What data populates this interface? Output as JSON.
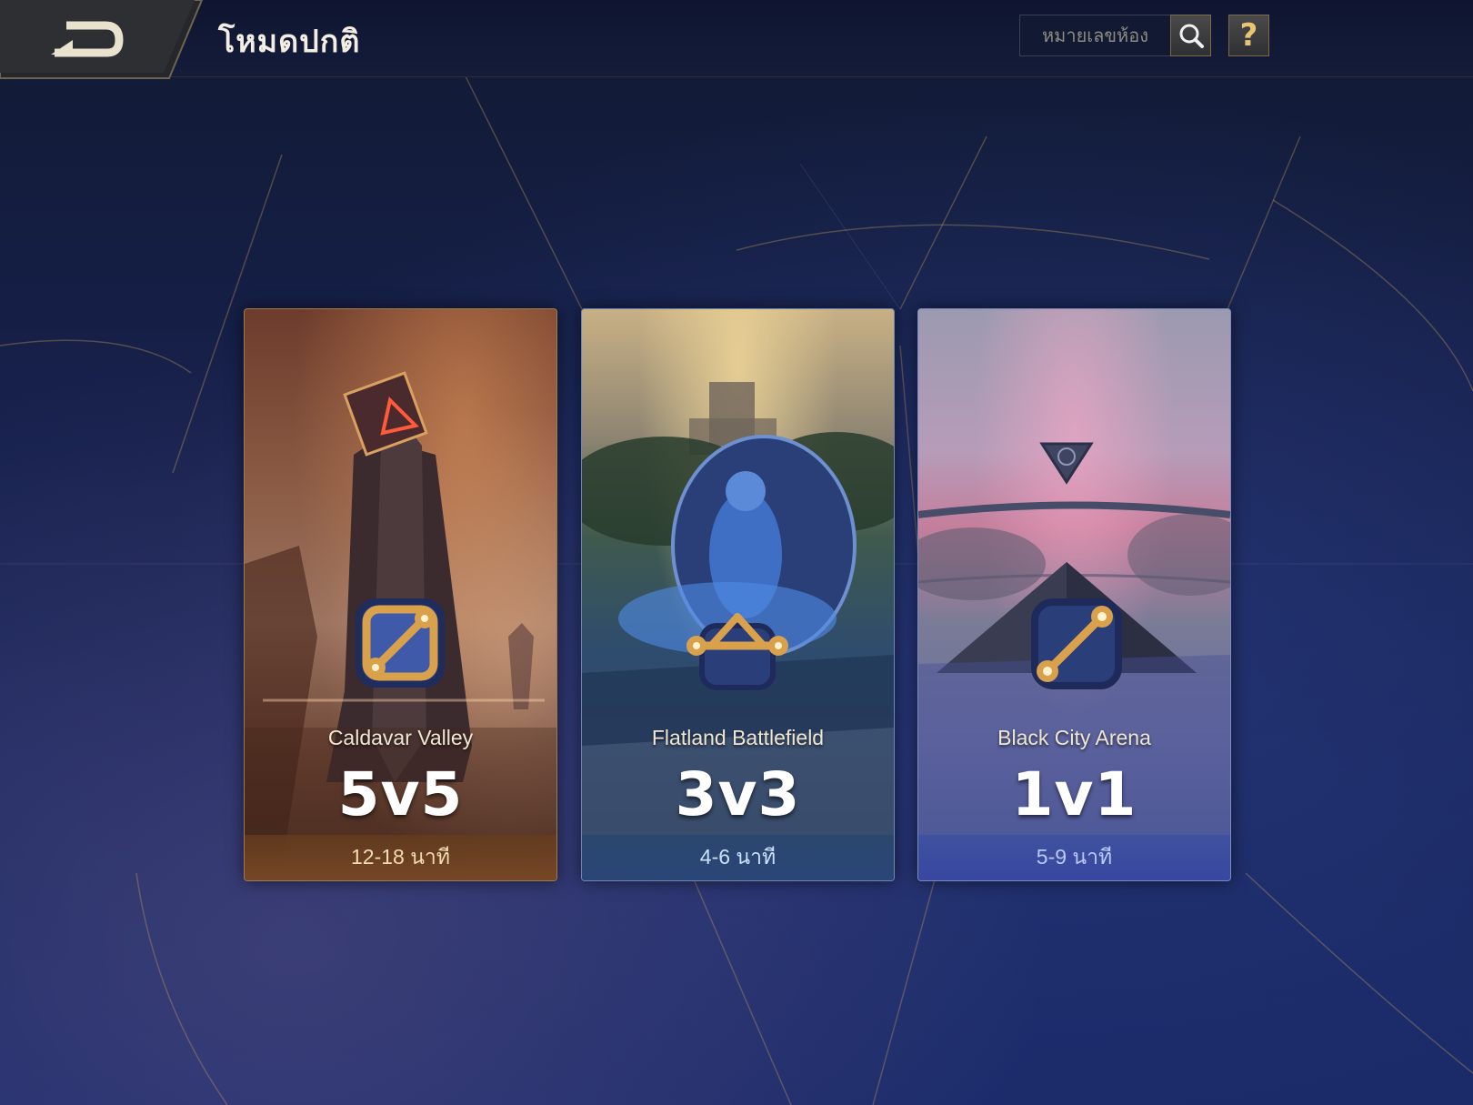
{
  "header": {
    "title": "โหมดปกติ",
    "room_search_placeholder": "หมายเลขห้อง",
    "help_label": "?"
  },
  "icons": {
    "back": "back-arrow-icon",
    "search": "search-icon",
    "help": "question-icon"
  },
  "colors": {
    "accent_gold": "#d9b56a",
    "background": "#16204a"
  },
  "modes": [
    {
      "map": "Caldavar Valley",
      "team_size": "5v5",
      "duration": "12-18 นาที"
    },
    {
      "map": "Flatland Battlefield",
      "team_size": "3v3",
      "duration": "4-6 นาที"
    },
    {
      "map": "Black City Arena",
      "team_size": "1v1",
      "duration": "5-9 นาที"
    }
  ]
}
